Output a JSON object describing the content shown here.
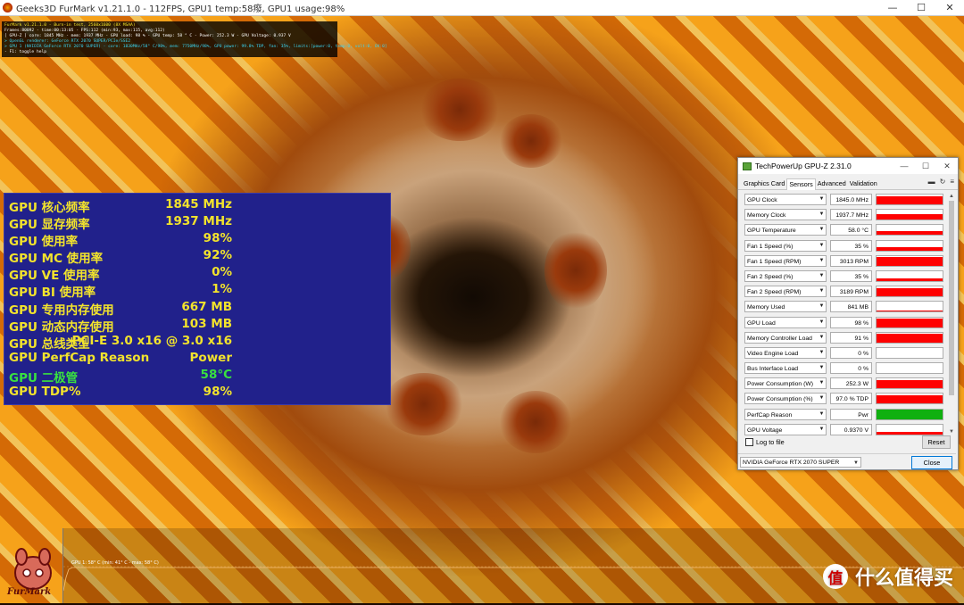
{
  "window": {
    "title": "Geeks3D FurMark v1.21.1.0 - 112FPS, GPU1 temp:58癈, GPU1 usage:98%",
    "min": "—",
    "max": "☐",
    "close": "✕"
  },
  "furmark_info": {
    "lines": [
      {
        "text": "FurMark v1.21.1.0 - Burn-in test, 2560x1600 (8X MSAA)",
        "color": "#f2e32c"
      },
      {
        "text": "Frames:80092 - time:00:13:05 - FPS:112 (min:93, max:115, avg:112)",
        "color": "#ffffff"
      },
      {
        "text": "[ GPU-Z ] core: 1845 MHz - mem: 1937 MHz - GPU load: 98 % - GPU temp: 58 ° C - Power: 252.3 W - GPU Voltage: 0.937 V",
        "color": "#ffffff"
      },
      {
        "text": "> OpenGL renderer: GeForce RTX 2070 SUPER/PCIe/SSE2",
        "color": "#3ad4f2"
      },
      {
        "text": "> GPU 1 (NVIDIA GeForce RTX 2070 SUPER) - core: 1830MHz/58° C/98%, mem: 7750MHz/98%, GPU power: 99.8% TDP, fan: 35%, limits:[power:0, temp:0, volt:0, OV:0]",
        "color": "#3ad4f2"
      },
      {
        "text": "- F1: toggle help",
        "color": "#ffffff"
      }
    ]
  },
  "osd": {
    "rows": [
      {
        "label": "GPU 核心频率",
        "value": "1845 MHz",
        "green": false
      },
      {
        "label": "GPU 显存频率",
        "value": "1937 MHz",
        "green": false
      },
      {
        "label": "GPU 使用率",
        "value": "98%",
        "green": false
      },
      {
        "label": "GPU MC 使用率",
        "value": "92%",
        "green": false
      },
      {
        "label": "GPU VE 使用率",
        "value": "0%",
        "green": false
      },
      {
        "label": "GPU BI 使用率",
        "value": "1%",
        "green": false
      },
      {
        "label": "GPU 专用内存使用",
        "value": "667 MB",
        "green": false
      },
      {
        "label": "GPU 动态内存使用",
        "value": "103 MB",
        "green": false
      },
      {
        "label": "GPU 总线类型",
        "value": "PCI-E 3.0 x16 @ 3.0 x16",
        "green": false
      },
      {
        "label": "GPU PerfCap Reason",
        "value": "Power",
        "green": false
      },
      {
        "label": "GPU 二极管",
        "value": "58°C",
        "green": true
      },
      {
        "label": "GPU TDP%",
        "value": "98%",
        "green": false
      }
    ]
  },
  "gpuz": {
    "title": "TechPowerUp GPU-Z 2.31.0",
    "tabs": [
      "Graphics Card",
      "Sensors",
      "Advanced",
      "Validation"
    ],
    "active_tab": "Sensors",
    "sensors": [
      {
        "name": "GPU Clock",
        "value": "1845.0 MHz",
        "level": 0.8,
        "color": "#ff0000"
      },
      {
        "name": "Memory Clock",
        "value": "1937.7 MHz",
        "level": 0.6,
        "color": "#ff0000"
      },
      {
        "name": "GPU Temperature",
        "value": "58.0 °C",
        "level": 0.4,
        "color": "#ff0000"
      },
      {
        "name": "Fan 1 Speed (%)",
        "value": "35 %",
        "level": 0.3,
        "color": "#ff0000"
      },
      {
        "name": "Fan 1 Speed (RPM)",
        "value": "3013 RPM",
        "level": 0.85,
        "color": "#ff0000"
      },
      {
        "name": "Fan 2 Speed (%)",
        "value": "35 %",
        "level": 0.3,
        "color": "#ff0000"
      },
      {
        "name": "Fan 2 Speed (RPM)",
        "value": "3189 RPM",
        "level": 0.85,
        "color": "#ff0000"
      },
      {
        "name": "Memory Used",
        "value": "841 MB",
        "level": 0.1,
        "color": "#ff0000"
      },
      {
        "name": "GPU Load",
        "value": "98 %",
        "level": 0.9,
        "color": "#ff0000"
      },
      {
        "name": "Memory Controller Load",
        "value": "91 %",
        "level": 0.85,
        "color": "#ff0000"
      },
      {
        "name": "Video Engine Load",
        "value": "0 %",
        "level": 0,
        "color": "#ff0000"
      },
      {
        "name": "Bus Interface Load",
        "value": "0 %",
        "level": 0.05,
        "color": "#ff0000"
      },
      {
        "name": "Power Consumption (W)",
        "value": "252.3 W",
        "level": 0.85,
        "color": "#ff0000"
      },
      {
        "name": "Power Consumption (%)",
        "value": "97.0 % TDP",
        "level": 0.85,
        "color": "#ff0000"
      },
      {
        "name": "PerfCap Reason",
        "value": "Pwr",
        "level": 1.0,
        "color": "#10b010"
      },
      {
        "name": "GPU Voltage",
        "value": "0.9370 V",
        "level": 0.3,
        "color": "#ff0000"
      }
    ],
    "log_label": "Log to file",
    "reset_label": "Reset",
    "device": "NVIDIA GeForce RTX 2070 SUPER",
    "close_label": "Close"
  },
  "temp_graph": {
    "caption": "GPU 1: 58° C (min: 41° C - max: 58° C)"
  },
  "logo": {
    "text": "FurMark"
  },
  "watermark": {
    "badge": "值",
    "text": "什么值得买"
  }
}
